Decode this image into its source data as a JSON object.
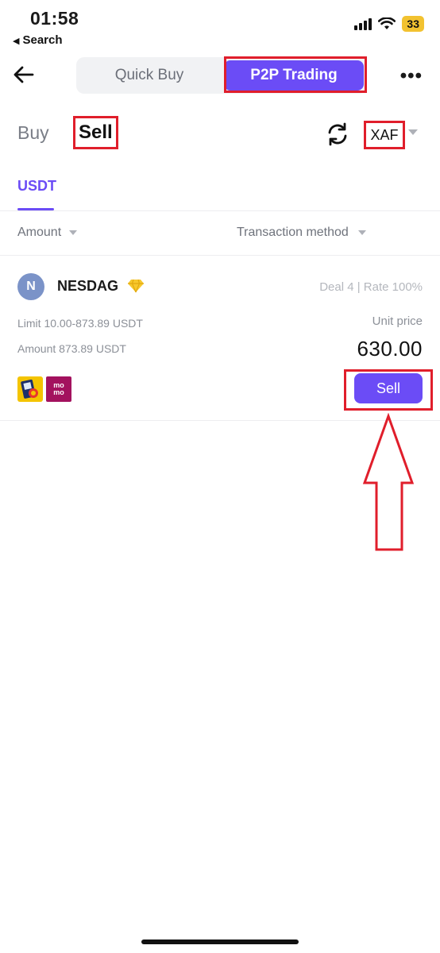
{
  "status_bar": {
    "time": "01:58",
    "back_app_label": "Search",
    "battery_level": "33"
  },
  "header": {
    "tabs": [
      {
        "label": "Quick Buy",
        "selected": false
      },
      {
        "label": "P2P Trading",
        "selected": true
      }
    ],
    "more_icon": "more-icon"
  },
  "trade": {
    "buy_label": "Buy",
    "sell_label": "Sell",
    "sell_selected": true,
    "currency": "XAF",
    "refresh_icon": "refresh-icon"
  },
  "asset_tab": {
    "label": "USDT"
  },
  "filters": {
    "amount_label": "Amount",
    "method_label": "Transaction method"
  },
  "listing": {
    "avatar_initial": "N",
    "merchant_name": "NESDAG",
    "badge_icon": "diamond-icon",
    "deal_stats": "Deal 4 | Rate 100%",
    "limit": "Limit 10.00-873.89 USDT",
    "amount": "Amount 873.89 USDT",
    "unit_price_label": "Unit price",
    "unit_price": "630.00",
    "payment_methods": [
      "MTN",
      "momo"
    ],
    "momo_text_top": "mo",
    "momo_text_bottom": "mo",
    "action_label": "Sell"
  },
  "colors": {
    "accent": "#6b4cf6",
    "highlight": "#e01e2b",
    "mtn_yellow": "#f4c400",
    "momo_purple": "#a3125e"
  }
}
